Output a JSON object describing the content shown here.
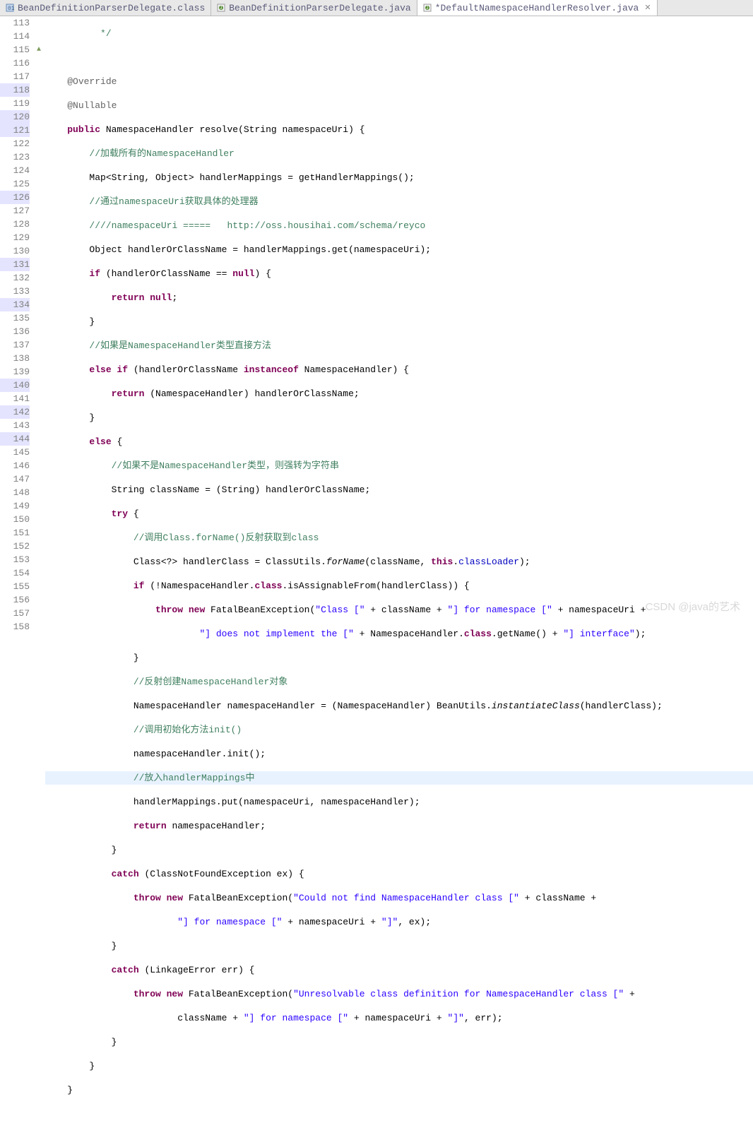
{
  "tabs": [
    {
      "icon": "class",
      "label": "BeanDefinitionParserDelegate.class",
      "active": false,
      "closable": false
    },
    {
      "icon": "java",
      "label": "BeanDefinitionParserDelegate.java",
      "active": false,
      "closable": false
    },
    {
      "icon": "java",
      "label": "*DefaultNamespaceHandlerResolver.java",
      "active": true,
      "closable": true
    }
  ],
  "watermark": "CSDN @java的艺术",
  "first_line": 113,
  "highlighted_gutter": [
    118,
    120,
    121,
    126,
    131,
    134,
    140,
    142,
    144
  ],
  "current_line": 144,
  "override_marker_line": 115,
  "code": {
    "l113": " */",
    "l114": "",
    "l115_a": "@Override",
    "l116_a": "@Nullable",
    "l117_pre": "public",
    "l117_mid": " NamespaceHandler resolve(String namespaceUri) {",
    "l118_c": "//加载所有的NamespaceHandler",
    "l119_a": "Map<String, Object> handlerMappings = getHandlerMappings();",
    "l120_c": "//通过namespaceUri获取具体的处理器",
    "l121_c": "////namespaceUri =====   http://oss.housihai.com/schema/reyco",
    "l122_a": "Object handlerOrClassName = handlerMappings.get(namespaceUri);",
    "l123_kw1": "if",
    "l123_mid": " (handlerOrClassName == ",
    "l123_kw2": "null",
    "l123_end": ") {",
    "l124_kw": "return null",
    "l124_end": ";",
    "l125": "}",
    "l126_c": "//如果是NamespaceHandler类型直接方法",
    "l127_kw1": "else if",
    "l127_mid": " (handlerOrClassName ",
    "l127_kw2": "instanceof",
    "l127_end": " NamespaceHandler) {",
    "l128_kw": "return",
    "l128_end": " (NamespaceHandler) handlerOrClassName;",
    "l129": "}",
    "l130_kw": "else",
    "l130_end": " {",
    "l131_c": "//如果不是NamespaceHandler类型，则强转为字符串",
    "l132": "String className = (String) handlerOrClassName;",
    "l133_kw": "try",
    "l133_end": " {",
    "l134_c": "//调用Class.forName()反射获取到class",
    "l135_a": "Class<?> handlerClass = ClassUtils.",
    "l135_m": "forName",
    "l135_b": "(className, ",
    "l135_kw": "this",
    "l135_c": ".",
    "l135_f": "classLoader",
    "l135_d": ");",
    "l136_kw": "if",
    "l136_a": " (!NamespaceHandler.",
    "l136_kw2": "class",
    "l136_b": ".isAssignableFrom(handlerClass)) {",
    "l137_kw": "throw new",
    "l137_a": " FatalBeanException(",
    "l137_s1": "\"Class [\"",
    "l137_b": " + className + ",
    "l137_s2": "\"] for namespace [\"",
    "l137_c": " + namespaceUri +",
    "l138_s1": "\"] does not implement the [\"",
    "l138_a": " + NamespaceHandler.",
    "l138_kw": "class",
    "l138_b": ".getName() + ",
    "l138_s2": "\"] interface\"",
    "l138_c": ");",
    "l139": "}",
    "l140_c": "//反射创建NamespaceHandler对象",
    "l141_a": "NamespaceHandler namespaceHandler = (NamespaceHandler) BeanUtils.",
    "l141_m": "instantiateClass",
    "l141_b": "(handlerClass);",
    "l142_c": "//调用初始化方法init()",
    "l143": "namespaceHandler.init();",
    "l144_c": "//放入handlerMappings中",
    "l145": "handlerMappings.put(namespaceUri, namespaceHandler);",
    "l146_kw": "return",
    "l146_end": " namespaceHandler;",
    "l147": "}",
    "l148_kw": "catch",
    "l148_end": " (ClassNotFoundException ex) {",
    "l149_kw": "throw new",
    "l149_a": " FatalBeanException(",
    "l149_s": "\"Could not find NamespaceHandler class [\"",
    "l149_b": " + className +",
    "l150_s": "\"] for namespace [\"",
    "l150_a": " + namespaceUri + ",
    "l150_s2": "\"]\"",
    "l150_b": ", ex);",
    "l151": "}",
    "l152_kw": "catch",
    "l152_end": " (LinkageError err) {",
    "l153_kw": "throw new",
    "l153_a": " FatalBeanException(",
    "l153_s": "\"Unresolvable class definition for NamespaceHandler class [\"",
    "l153_b": " +",
    "l154_a": "className + ",
    "l154_s": "\"] for namespace [\"",
    "l154_b": " + namespaceUri + ",
    "l154_s2": "\"]\"",
    "l154_c": ", err);",
    "l155": "}",
    "l156": "}",
    "l157": "}"
  }
}
